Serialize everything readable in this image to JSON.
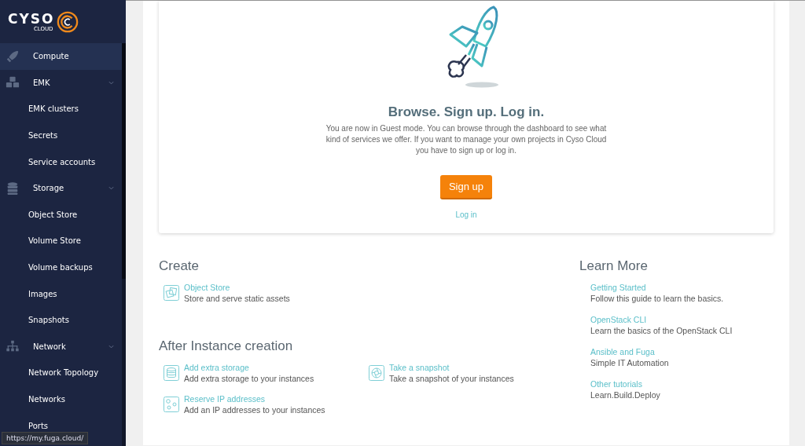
{
  "logo": {
    "name": "CYSO",
    "sub": "CLOUD"
  },
  "sidebar": {
    "items": [
      {
        "label": "Compute",
        "kind": "link",
        "selected": true
      },
      {
        "label": "EMK",
        "kind": "section",
        "selected": false,
        "children": [
          {
            "label": "EMK clusters",
            "selected": false
          },
          {
            "label": "Secrets",
            "selected": false
          },
          {
            "label": "Service accounts",
            "selected": false
          }
        ]
      },
      {
        "label": "Storage",
        "kind": "section",
        "selected": false,
        "children": [
          {
            "label": "Object Store",
            "selected": false
          },
          {
            "label": "Volume Store",
            "selected": false
          },
          {
            "label": "Volume backups",
            "selected": false
          },
          {
            "label": "Images",
            "selected": false
          },
          {
            "label": "Snapshots",
            "selected": false
          }
        ]
      },
      {
        "label": "Network",
        "kind": "section",
        "selected": false,
        "children": [
          {
            "label": "Network Topology",
            "selected": false
          },
          {
            "label": "Networks",
            "selected": false
          },
          {
            "label": "Ports",
            "selected": false
          }
        ]
      }
    ]
  },
  "hero": {
    "title": "Browse. Sign up. Log in.",
    "text": "You are now in Guest mode. You can browse through the dashboard to see what kind of services we offer. If you want to manage your own projects in Cyso Cloud you have to sign up or log in.",
    "primary_button": "Sign up",
    "link": "Log in"
  },
  "create": {
    "title": "Create",
    "items": [
      {
        "kind": "object-store",
        "title": "Object Store",
        "text": "Store and serve static assets"
      }
    ]
  },
  "after": {
    "title": "After Instance creation",
    "items": [
      {
        "kind": "storage",
        "title": "Add extra storage",
        "text": "Add extra storage to your instances"
      },
      {
        "kind": "snapshot",
        "title": "Take a snapshot",
        "text": "Take a snapshot of your instances"
      },
      {
        "kind": "ip",
        "title": "Reserve IP addresses",
        "text": "Add an IP addresses to your instances"
      }
    ]
  },
  "learn": {
    "title": "Learn More",
    "items": [
      {
        "title": "Getting Started",
        "text": "Follow this guide to learn the basics."
      },
      {
        "title": "OpenStack CLI",
        "text": "Learn the basics of the OpenStack CLI"
      },
      {
        "title": "Ansible and Fuga",
        "text": "Simple IT Automation"
      },
      {
        "title": "Other tutorials",
        "text": "Learn.Build.Deploy"
      }
    ]
  },
  "status_url": "https://my.fuga.cloud/"
}
